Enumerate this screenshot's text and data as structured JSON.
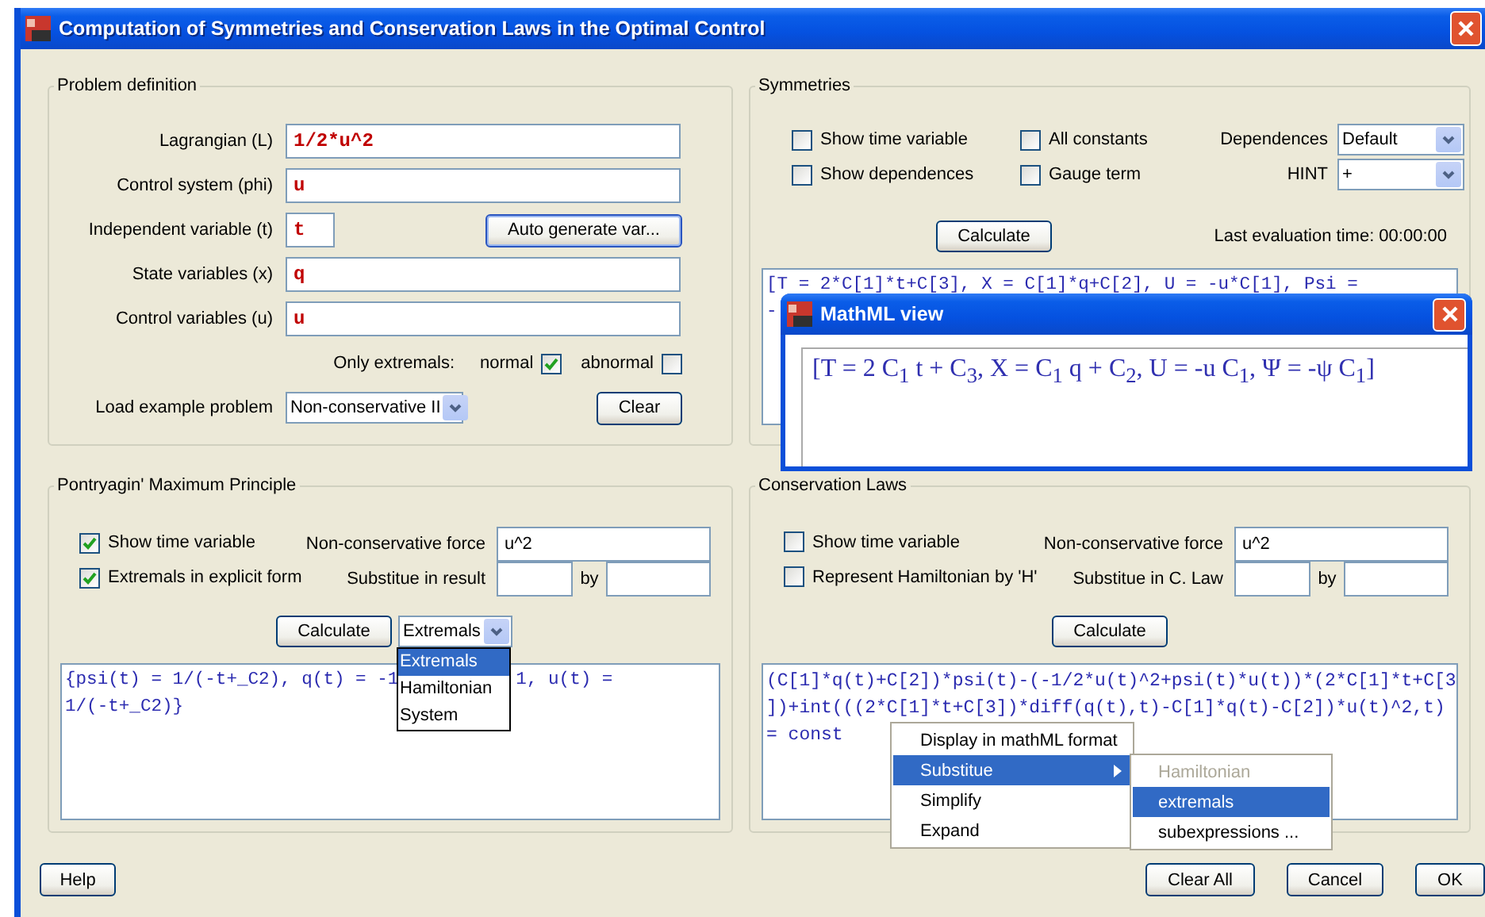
{
  "window": {
    "title": "Computation of Symmetries and Conservation Laws in the Optimal Control"
  },
  "problem_definition": {
    "title": "Problem definition",
    "fields": [
      {
        "label": "Lagrangian (L)",
        "value": "1/2*u^2",
        "kind": "wide"
      },
      {
        "label": "Control system (phi)",
        "value": "u",
        "kind": "wide"
      },
      {
        "label": "Independent variable (t)",
        "value": "t",
        "kind": "short"
      },
      {
        "label": "State variables (x)",
        "value": "q",
        "kind": "wide"
      },
      {
        "label": "Control variables (u)",
        "value": "u",
        "kind": "wide"
      }
    ],
    "auto_generate_button": "Auto generate var...",
    "only_extremals": {
      "label": "Only extremals:",
      "options": [
        {
          "label": "normal",
          "checked": true
        },
        {
          "label": "abnormal",
          "checked": false
        }
      ]
    },
    "load_example": {
      "label": "Load example problem",
      "value": "Non-conservative II"
    },
    "clear_button": "Clear"
  },
  "symmetries": {
    "title": "Symmetries",
    "checkboxes": [
      {
        "label": "Show time variable",
        "checked": false
      },
      {
        "label": "All constants",
        "checked": false
      },
      {
        "label": "Show dependences",
        "checked": false
      },
      {
        "label": "Gauge term",
        "checked": false
      }
    ],
    "dropdowns": [
      {
        "label": "Dependences",
        "value": "Default"
      },
      {
        "label": "HINT",
        "value": "+"
      }
    ],
    "calculate_button": "Calculate",
    "last_evaluation": "Last evaluation time: 00:00:00",
    "output_lines": [
      "[T = 2*C[1]*t+C[3], X = C[1]*q+C[2], U = -u*C[1], Psi =",
      "-"
    ]
  },
  "pontryagin": {
    "title": "Pontryagin' Maximum Principle",
    "checkboxes": [
      {
        "label": "Show time variable",
        "checked": true
      },
      {
        "label": "Extremals in explicit form",
        "checked": true
      }
    ],
    "nonconservative_force": {
      "label": "Non-conservative force",
      "value": "u^2"
    },
    "substitute": {
      "label": "Substitue in result",
      "by": "by"
    },
    "calculate_button": "Calculate",
    "result_select": {
      "value": "Extremals",
      "options": [
        {
          "label": "Extremals",
          "selected": true
        },
        {
          "label": "Hamiltonian",
          "selected": false
        },
        {
          "label": "System",
          "selected": false
        }
      ]
    },
    "output_lines": [
      [
        "{psi(t) = 1/(-t+_C2), q(t) = -1",
        "1, u(t) ="
      ],
      [
        "1/(-t+_C2)}"
      ]
    ]
  },
  "conservation_laws": {
    "title": "Conservation Laws",
    "checkboxes": [
      {
        "label": "Show time variable",
        "checked": false
      },
      {
        "label": "Represent Hamiltonian by 'H'",
        "checked": false
      }
    ],
    "nonconservative_force": {
      "label": "Non-conservative force",
      "value": "u^2"
    },
    "substitute": {
      "label": "Substitue in C. Law",
      "by": "by"
    },
    "calculate_button": "Calculate",
    "output_lines": [
      "(C[1]*q(t)+C[2])*psi(t)-(-1/2*u(t)^2+psi(t)*u(t))*(2*C[1]*t+C[3",
      "])+int(((2*C[1]*t+C[3])*diff(q(t),t)-C[1]*q(t)-C[2])*u(t)^2,t)",
      "= const"
    ],
    "context_menu": [
      {
        "label": "Display in mathML format",
        "selected": false,
        "has_submenu": false
      },
      {
        "label": "Substitue",
        "selected": true,
        "has_submenu": true
      },
      {
        "label": "Simplify",
        "selected": false,
        "has_submenu": false
      },
      {
        "label": "Expand",
        "selected": false,
        "has_submenu": false
      }
    ],
    "submenu": [
      {
        "label": "Hamiltonian",
        "selected": false,
        "disabled": true
      },
      {
        "label": "extremals",
        "selected": true,
        "disabled": false
      },
      {
        "label": "subexpressions ...",
        "selected": false,
        "disabled": false
      }
    ]
  },
  "buttons": [
    "Help",
    "Clear All",
    "Cancel",
    "OK"
  ],
  "mathml_window": {
    "title": "MathML view",
    "content": "[T = 2 C$_{1}$ t + C$_{3}$, X = C$_{1}$ q + C$_{2}$, U = -u C$_{1}$, Ψ = -ψ C$_{1}$]"
  }
}
